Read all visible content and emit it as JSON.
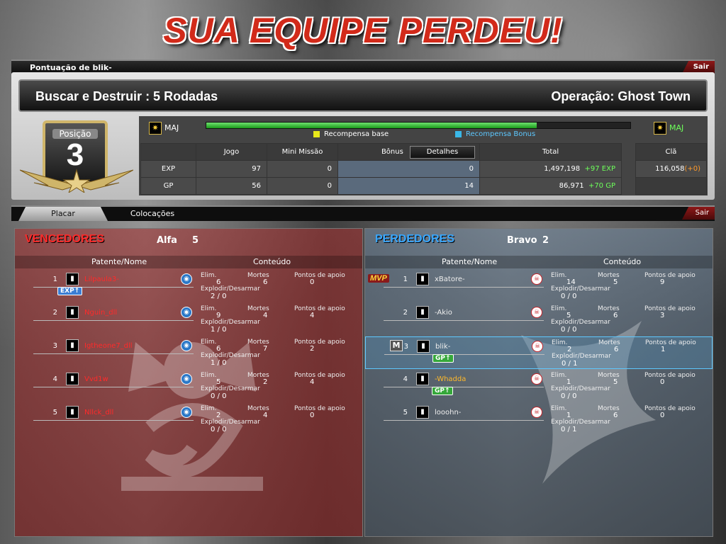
{
  "banner": "SUA EQUIPE PERDEU!",
  "score_panel": {
    "title": "Pontuação de blik-",
    "exit": "Sair"
  },
  "mode": {
    "left": "Buscar e Destruir : 5 Rodadas",
    "right": "Operação: Ghost Town"
  },
  "position": {
    "label": "Posição",
    "value": "3"
  },
  "rank": {
    "current": "MAJ",
    "next": "MAJ",
    "progress": 0.78
  },
  "legend": {
    "base": "Recompensa base",
    "bonus": "Recompensa Bonus"
  },
  "stats": {
    "headers": {
      "game": "Jogo",
      "mini": "Mini Missão",
      "bonus": "Bônus",
      "details": "Detalhes",
      "total": "Total",
      "clan": "Clã"
    },
    "exp": {
      "label": "EXP",
      "game": "97",
      "mini": "0",
      "bonus": "0",
      "total": "1,497,198",
      "gain": "+97 EXP",
      "clan": "116,058",
      "clan_gain": "(+0)"
    },
    "gp": {
      "label": "GP",
      "game": "56",
      "mini": "0",
      "bonus": "14",
      "total": "86,971",
      "gain": "+70 GP"
    }
  },
  "tabs": {
    "placar": "Placar",
    "colocacoes": "Colocações",
    "exit": "Sair"
  },
  "col_headers": {
    "name": "Patente/Nome",
    "content": "Conteúdo"
  },
  "stat_labels": {
    "kills": "Elim.",
    "deaths": "Mortes",
    "support": "Pontos de apoio",
    "defuse": "Explodir/Desarmar"
  },
  "winners": {
    "title": "VENCEDORES",
    "team": "Alfa",
    "score": "5",
    "players": [
      {
        "pos": "1",
        "rank": "2",
        "name": "Lilpaula3-",
        "kills": "6",
        "deaths": "6",
        "support": "0",
        "defuse": "2 / 0",
        "badge": "EXP"
      },
      {
        "pos": "2",
        "rank": "1",
        "name": "Nguin_dll",
        "kills": "9",
        "deaths": "4",
        "support": "4",
        "defuse": "1 / 0",
        "badge": ""
      },
      {
        "pos": "3",
        "rank": "3",
        "name": "Igtheone7_dll",
        "kills": "6",
        "deaths": "7",
        "support": "2",
        "defuse": "1 / 0",
        "badge": ""
      },
      {
        "pos": "4",
        "rank": "4",
        "name": "Vvd1w",
        "kills": "5",
        "deaths": "2",
        "support": "4",
        "defuse": "0 / 0",
        "badge": ""
      },
      {
        "pos": "5",
        "rank": "2",
        "name": "Nllck_dll",
        "kills": "2",
        "deaths": "4",
        "support": "0",
        "defuse": "0 / 0",
        "badge": ""
      }
    ]
  },
  "losers": {
    "title": "PERDEDORES",
    "team": "Bravo",
    "score": "2",
    "players": [
      {
        "pos": "1",
        "rank": "5",
        "name": "xBatore-",
        "kills": "14",
        "deaths": "5",
        "support": "9",
        "defuse": "0 / 0",
        "badge": "",
        "tag": "MVP"
      },
      {
        "pos": "2",
        "rank": "4",
        "name": "-Akio",
        "kills": "5",
        "deaths": "6",
        "support": "3",
        "defuse": "0 / 0",
        "badge": "",
        "tag": ""
      },
      {
        "pos": "3",
        "rank": "1",
        "name": "blik-",
        "kills": "2",
        "deaths": "6",
        "support": "1",
        "defuse": "0 / 1",
        "badge": "GP",
        "tag": "M"
      },
      {
        "pos": "4",
        "rank": "5",
        "name": "-Whadda",
        "kills": "1",
        "deaths": "5",
        "support": "0",
        "defuse": "0 / 0",
        "badge": "GP",
        "tag": ""
      },
      {
        "pos": "5",
        "rank": "4",
        "name": "looohn-",
        "kills": "1",
        "deaths": "6",
        "support": "0",
        "defuse": "0 / 1",
        "badge": "",
        "tag": ""
      }
    ]
  },
  "colors": {
    "accent_red": "#d22a1a",
    "win_team": "#a03232",
    "lose_team": "#6e8296",
    "gain": "#6dff5a"
  }
}
